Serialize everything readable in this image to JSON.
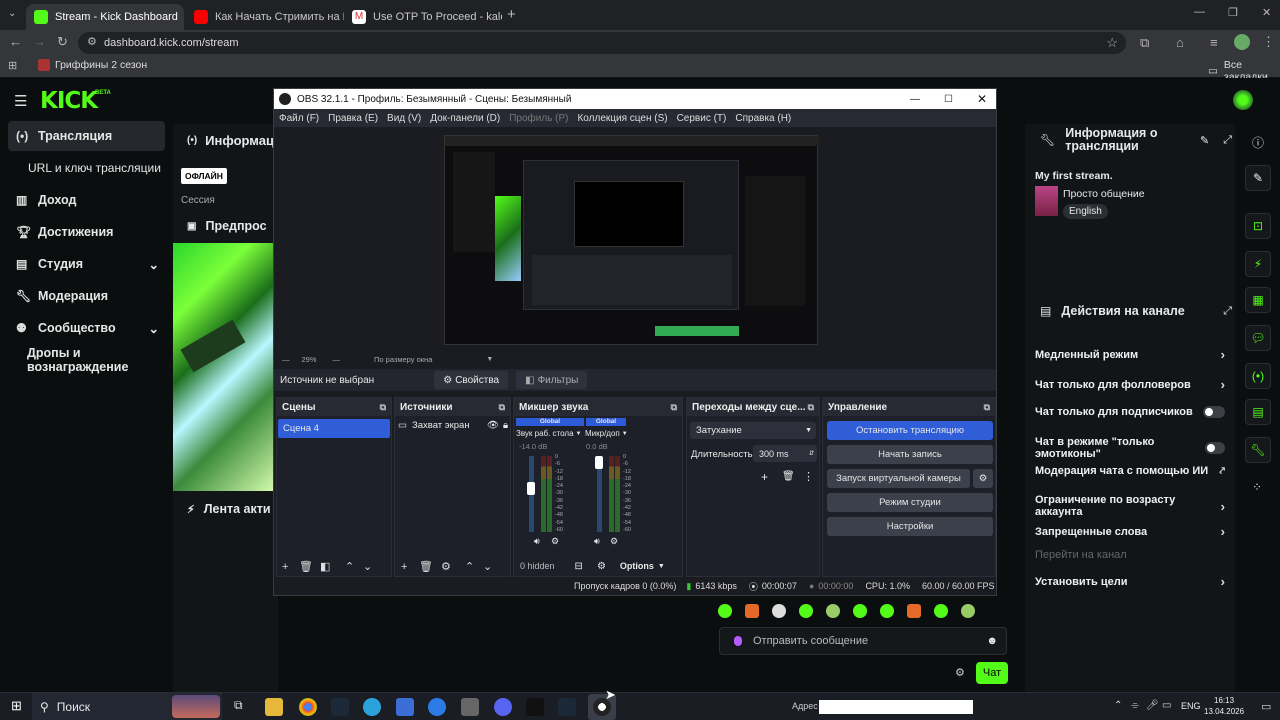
{
  "browser": {
    "tabs": [
      {
        "label": "Stream - Kick Dashboard",
        "active": true
      },
      {
        "label": "Как Начать Стримить на Kick",
        "active": false
      },
      {
        "label": "Use OTP To Proceed - kaleyka0",
        "active": false
      }
    ],
    "url": "dashboard.kick.com/stream",
    "bookmark": "Гриффины 2 сезон",
    "all_bookmarks": "Все закладки"
  },
  "kick": {
    "logo": "KICK",
    "beta": "BETA",
    "sidebar": [
      {
        "label": "Трансляция",
        "icon": "broadcast-icon"
      },
      {
        "label": "URL и ключ трансляции",
        "icon": ""
      },
      {
        "label": "Доход",
        "icon": "chart-icon"
      },
      {
        "label": "Достижения",
        "icon": "trophy-icon"
      },
      {
        "label": "Студия",
        "icon": "studio-icon"
      },
      {
        "label": "Модерация",
        "icon": "wrench-icon"
      },
      {
        "label": "Сообщество",
        "icon": "community-icon"
      },
      {
        "label": "Дропы и вознаграждение",
        "icon": ""
      }
    ],
    "main": {
      "section_title": "Информац",
      "status_badge": "ОФЛАЙН",
      "session": "Сессия",
      "preview_title": "Предпрос",
      "feed_title": "Лента акти"
    },
    "info": {
      "title": "Информация о трансляции",
      "stream_title": "My first stream.",
      "category": "Просто общение",
      "language": "English"
    },
    "actions": {
      "title": "Действия на канале",
      "items": [
        {
          "label": "Медленный режим",
          "control": "chevron"
        },
        {
          "label": "Чат только для фолловеров",
          "control": "chevron"
        },
        {
          "label": "Чат только для подписчиков",
          "control": "toggle"
        },
        {
          "label": "Чат в режиме \"только эмотиконы\"",
          "control": "toggle"
        },
        {
          "label": "Модерация чата с помощью ИИ",
          "control": "external"
        },
        {
          "label": "Ограничение по возрасту аккаунта",
          "control": "chevron"
        },
        {
          "label": "Запрещенные слова",
          "control": "chevron"
        },
        {
          "label": "Перейти на канал",
          "control": "none"
        },
        {
          "label": "Установить цели",
          "control": "chevron"
        }
      ]
    },
    "chat": {
      "placeholder": "Отправить сообщение",
      "send": "Чат"
    }
  },
  "obs": {
    "title": "OBS 32.1.1 - Профиль: Безымянный - Сцены: Безымянный",
    "menu": [
      "Файл (F)",
      "Правка (E)",
      "Вид (V)",
      "Док-панели (D)",
      "Профиль (P)",
      "Коллекция сцен (S)",
      "Сервис (T)",
      "Справка (H)"
    ],
    "zoom": "29%",
    "fit": "По размеру окна",
    "source_none": "Источник не выбран",
    "properties": "Свойства",
    "filters": "Фильтры",
    "scenes": {
      "title": "Сцены",
      "items": [
        "Сцена 4"
      ]
    },
    "sources": {
      "title": "Источники",
      "items": [
        "Захват экран"
      ]
    },
    "mixer": {
      "title": "Микшер звука",
      "channels": [
        {
          "tag": "Global",
          "name": "Звук раб. стола",
          "db": "-14.0 dB"
        },
        {
          "tag": "Global",
          "name": "Микр/доп",
          "db": "0.0 dB"
        }
      ],
      "scale": [
        "0",
        "-6",
        "-12",
        "-18",
        "-24",
        "-30",
        "-36",
        "-42",
        "-48",
        "-54",
        "-60"
      ],
      "hidden": "0 hidden",
      "options": "Options"
    },
    "transitions": {
      "title": "Переходы между сце...",
      "type": "Затухание",
      "duration_label": "Длительность",
      "duration": "300 ms"
    },
    "controls": {
      "title": "Управление",
      "buttons": [
        "Остановить трансляцию",
        "Начать запись",
        "Запуск виртуальной камеры",
        "Режим студии",
        "Настройки"
      ]
    },
    "status": {
      "dropped": "Пропуск кадров 0 (0.0%)",
      "kbps": "6143 kbps",
      "live_time": "00:00:07",
      "rec_time": "00:00:00",
      "cpu": "CPU: 1.0%",
      "fps": "60.00 / 60.00 FPS"
    }
  },
  "taskbar": {
    "search": "Поиск",
    "address_label": "Адрес",
    "lang": "ENG",
    "time": "16:13",
    "date": "13.04.2026"
  }
}
